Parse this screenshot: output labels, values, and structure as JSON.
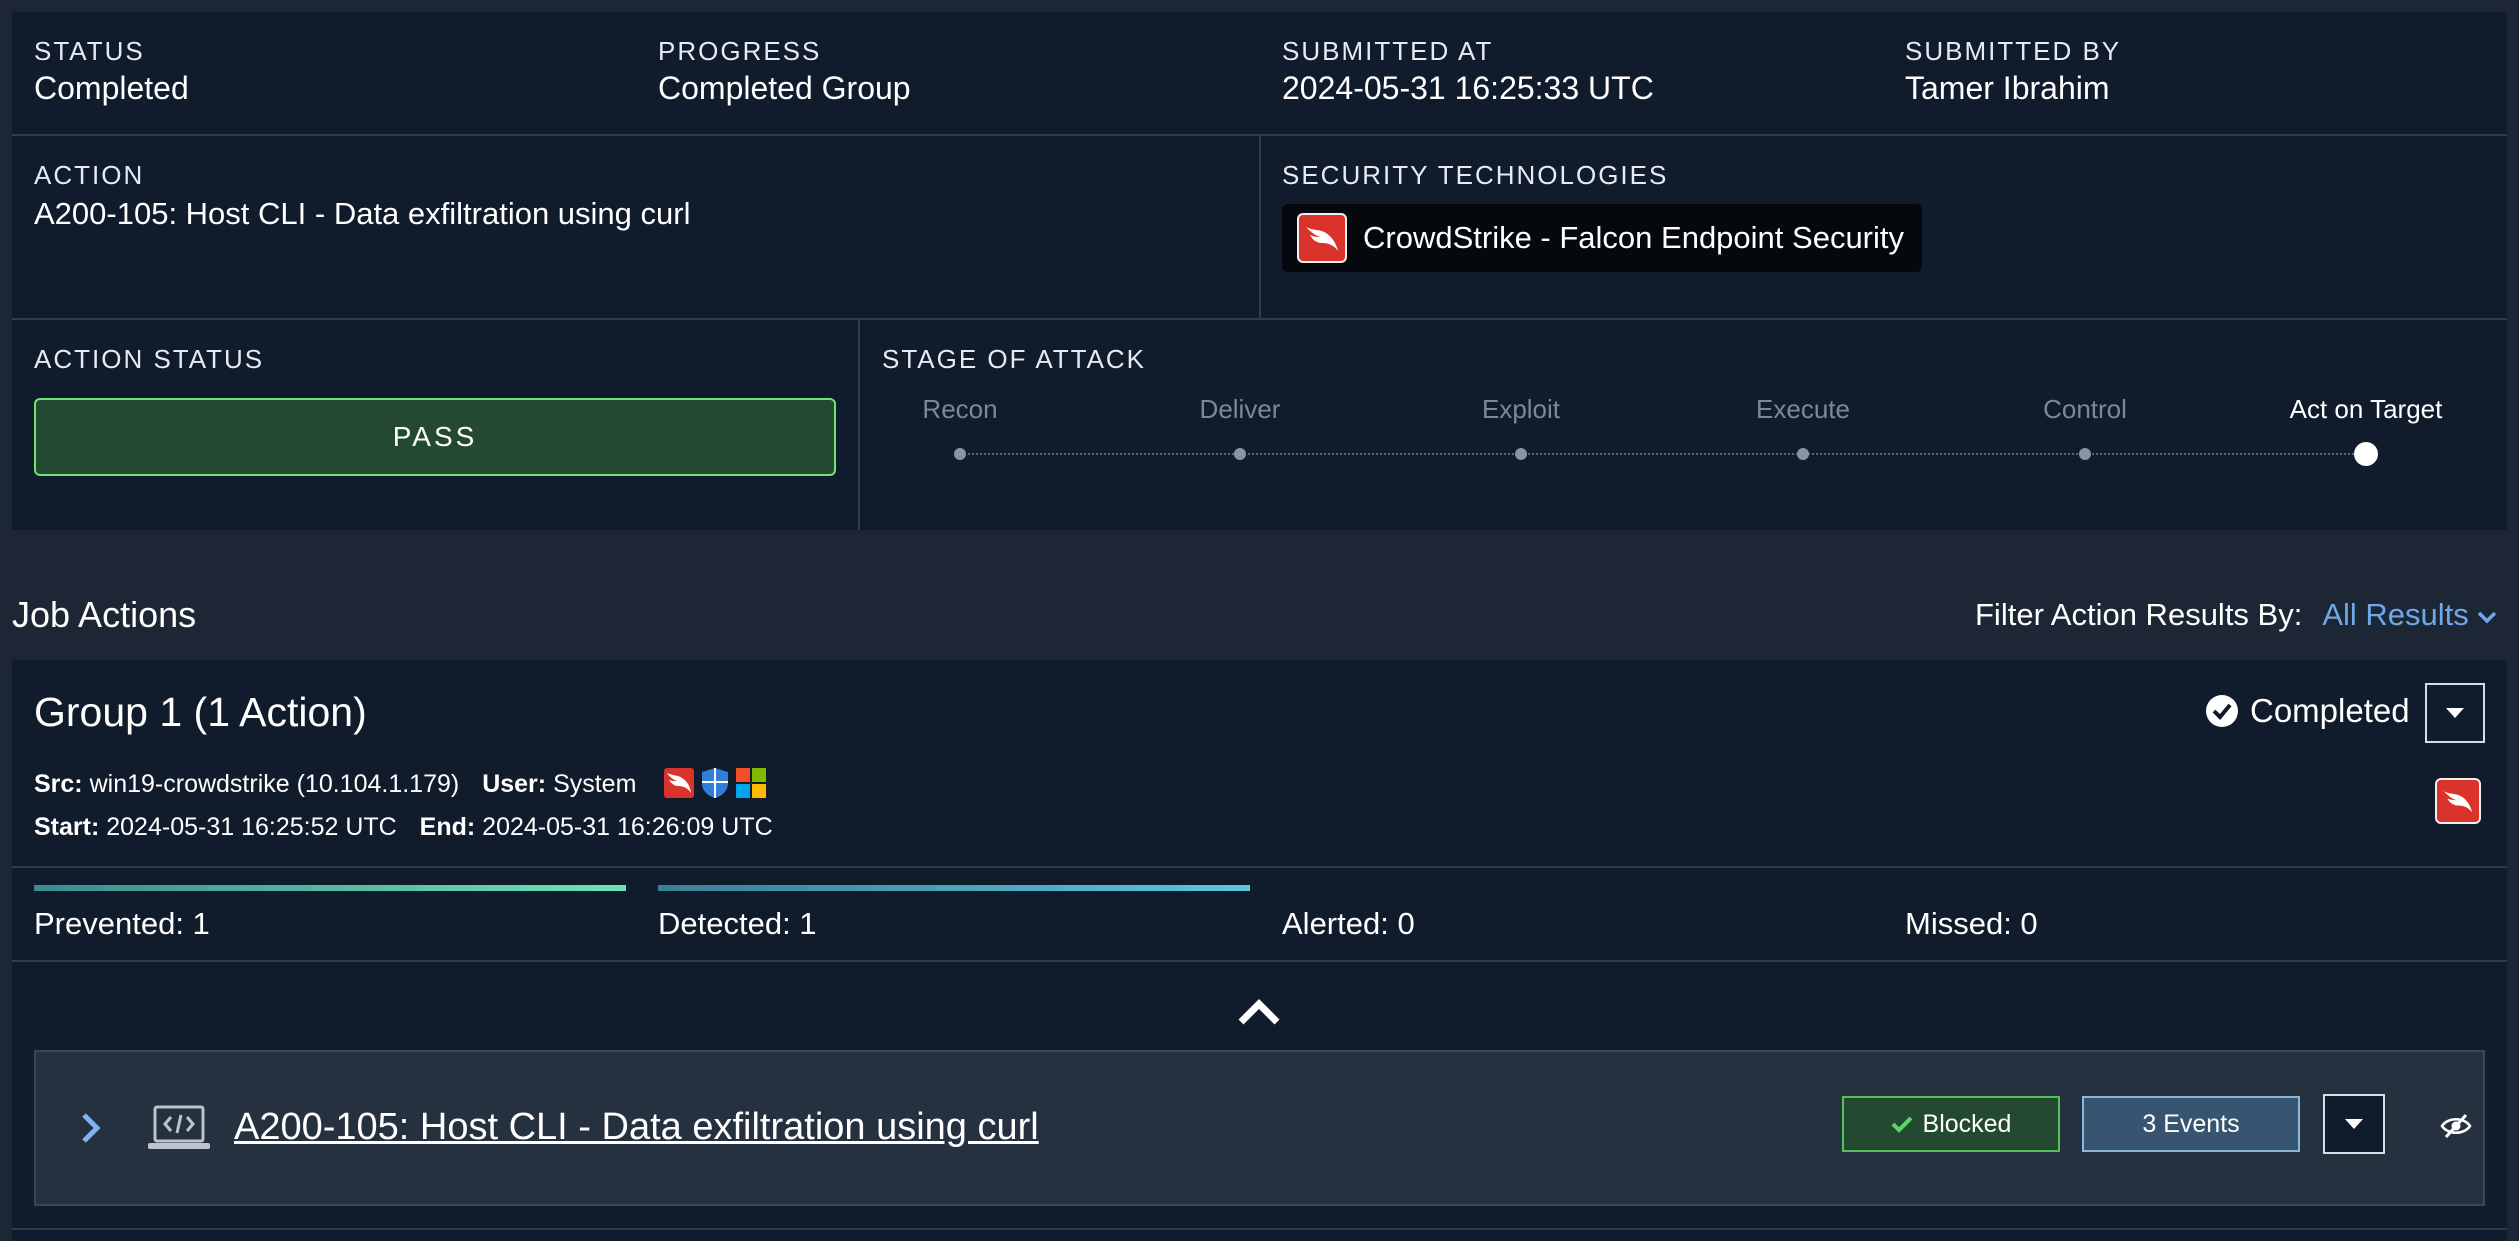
{
  "summary": {
    "status_label": "STATUS",
    "status_value": "Completed",
    "progress_label": "PROGRESS",
    "progress_value": "Completed Group",
    "submitted_at_label": "SUBMITTED AT",
    "submitted_at_value": "2024-05-31 16:25:33 UTC",
    "submitted_by_label": "SUBMITTED BY",
    "submitted_by_value": "Tamer Ibrahim"
  },
  "action": {
    "label": "ACTION",
    "value": "A200-105: Host CLI - Data exfiltration using curl"
  },
  "security_technologies": {
    "label": "SECURITY TECHNOLOGIES",
    "items": [
      {
        "name": "CrowdStrike - Falcon Endpoint Security",
        "icon": "crowdstrike-falcon-icon",
        "color": "#d9332b"
      }
    ]
  },
  "action_status": {
    "label": "ACTION STATUS",
    "value": "PASS",
    "color": "#6fe36f"
  },
  "stage_of_attack": {
    "label": "STAGE OF ATTACK",
    "stages": [
      "Recon",
      "Deliver",
      "Exploit",
      "Execute",
      "Control",
      "Act on Target"
    ],
    "active_stage": "Act on Target"
  },
  "job_actions": {
    "title": "Job Actions",
    "filter_label": "Filter Action Results By:",
    "filter_value": "All Results"
  },
  "group": {
    "title": "Group 1 (1 Action)",
    "status": "Completed",
    "src_label": "Src:",
    "src_value": "win19-crowdstrike (10.104.1.179)",
    "user_label": "User:",
    "user_value": "System",
    "start_label": "Start:",
    "start_value": "2024-05-31 16:25:52 UTC",
    "end_label": "End:",
    "end_value": "2024-05-31 16:26:09 UTC",
    "os_icons": [
      "crowdstrike-icon",
      "defender-shield-icon",
      "windows-icon"
    ],
    "counts": {
      "prevented": "Prevented: 1",
      "detected": "Detected: 1",
      "alerted": "Alerted: 0",
      "missed": "Missed: 0"
    },
    "colors": {
      "prevented": "#6fe3b5",
      "detected": "#5bc6dc"
    }
  },
  "action_item": {
    "title": "A200-105: Host CLI - Data exfiltration using curl",
    "icon": "laptop-code-icon",
    "result": "Blocked",
    "events": "3 Events"
  }
}
